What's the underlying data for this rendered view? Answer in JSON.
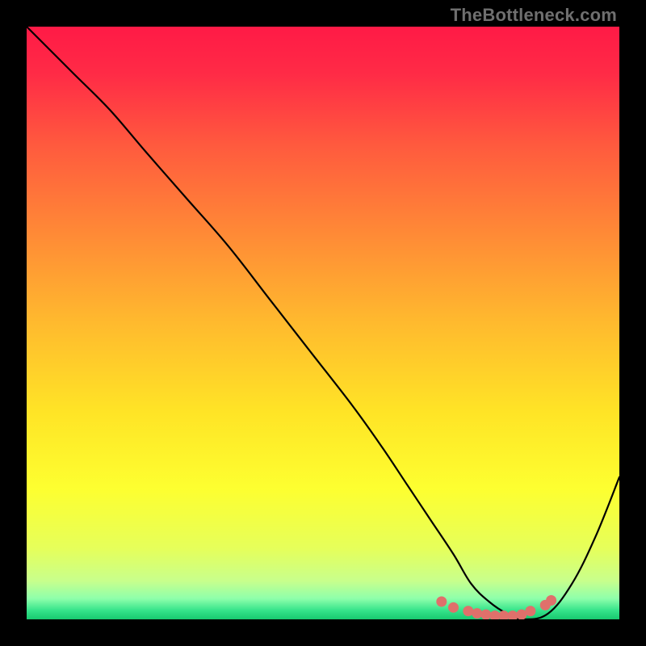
{
  "watermark": "TheBottleneck.com",
  "chart_data": {
    "type": "line",
    "title": "",
    "xlabel": "",
    "ylabel": "",
    "xlim": [
      0,
      100
    ],
    "ylim": [
      0,
      100
    ],
    "grid": false,
    "legend": false,
    "background_gradient": {
      "stops": [
        {
          "offset": 0.0,
          "color": "#ff1a46"
        },
        {
          "offset": 0.08,
          "color": "#ff2b46"
        },
        {
          "offset": 0.2,
          "color": "#ff5a3e"
        },
        {
          "offset": 0.35,
          "color": "#ff8a36"
        },
        {
          "offset": 0.5,
          "color": "#ffba2e"
        },
        {
          "offset": 0.65,
          "color": "#ffe426"
        },
        {
          "offset": 0.78,
          "color": "#fdff30"
        },
        {
          "offset": 0.88,
          "color": "#e6ff5a"
        },
        {
          "offset": 0.935,
          "color": "#c8ff8c"
        },
        {
          "offset": 0.965,
          "color": "#8effab"
        },
        {
          "offset": 0.985,
          "color": "#35e38a"
        },
        {
          "offset": 1.0,
          "color": "#18c86f"
        }
      ]
    },
    "series": [
      {
        "name": "bottleneck-curve",
        "note": "y is bottleneck/divergence percentage; 0 = ideal match",
        "x": [
          0,
          3,
          8,
          14,
          20,
          27,
          34,
          41,
          48,
          55,
          60,
          64,
          68,
          72,
          75,
          78,
          81,
          84,
          88,
          92,
          96,
          100
        ],
        "y": [
          100,
          97,
          92,
          86,
          79,
          71,
          63,
          54,
          45,
          36,
          29,
          23,
          17,
          11,
          6,
          3,
          1,
          0,
          1,
          6,
          14,
          24
        ]
      }
    ],
    "optimal_markers": {
      "note": "cluster of red dots marking the valley (best match zone)",
      "points": [
        {
          "x": 70,
          "y": 3.0
        },
        {
          "x": 72,
          "y": 2.0
        },
        {
          "x": 74.5,
          "y": 1.4
        },
        {
          "x": 76,
          "y": 1.0
        },
        {
          "x": 77.5,
          "y": 0.8
        },
        {
          "x": 79,
          "y": 0.6
        },
        {
          "x": 80.5,
          "y": 0.6
        },
        {
          "x": 82,
          "y": 0.6
        },
        {
          "x": 83.5,
          "y": 0.8
        },
        {
          "x": 85,
          "y": 1.4
        },
        {
          "x": 87.5,
          "y": 2.4
        },
        {
          "x": 88.5,
          "y": 3.2
        }
      ]
    }
  }
}
